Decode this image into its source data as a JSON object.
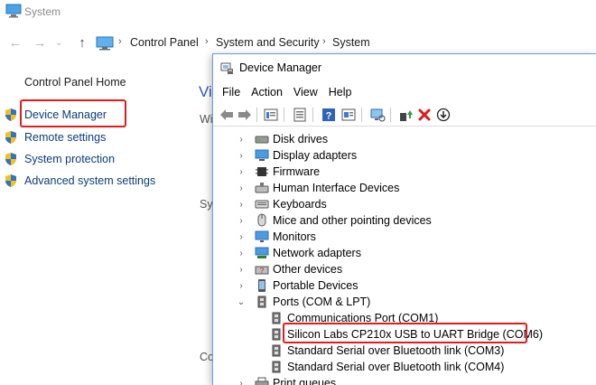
{
  "system_window": {
    "title": "System",
    "breadcrumbs": [
      "Control Panel",
      "System and Security",
      "System"
    ],
    "sidebar": {
      "home": "Control Panel Home",
      "items": [
        {
          "label": "Device Manager",
          "icon": "shield-icon"
        },
        {
          "label": "Remote settings",
          "icon": "shield-icon"
        },
        {
          "label": "System protection",
          "icon": "shield-icon"
        },
        {
          "label": "Advanced system settings",
          "icon": "shield-icon"
        }
      ]
    },
    "peek_text": {
      "heading": "Vi",
      "w": "Wi",
      "sy": "Sy",
      "co": "Co"
    }
  },
  "device_manager": {
    "title": "Device Manager",
    "menu": [
      "File",
      "Action",
      "View",
      "Help"
    ],
    "tree": [
      {
        "label": "Disk drives",
        "expanded": false,
        "icon": "disk-drive-icon"
      },
      {
        "label": "Display adapters",
        "expanded": false,
        "icon": "display-adapter-icon"
      },
      {
        "label": "Firmware",
        "expanded": false,
        "icon": "firmware-icon"
      },
      {
        "label": "Human Interface Devices",
        "expanded": false,
        "icon": "hid-icon"
      },
      {
        "label": "Keyboards",
        "expanded": false,
        "icon": "keyboard-icon"
      },
      {
        "label": "Mice and other pointing devices",
        "expanded": false,
        "icon": "mouse-icon"
      },
      {
        "label": "Monitors",
        "expanded": false,
        "icon": "monitor-icon"
      },
      {
        "label": "Network adapters",
        "expanded": false,
        "icon": "network-adapter-icon"
      },
      {
        "label": "Other devices",
        "expanded": false,
        "icon": "other-devices-icon"
      },
      {
        "label": "Portable Devices",
        "expanded": false,
        "icon": "portable-device-icon"
      },
      {
        "label": "Ports (COM & LPT)",
        "expanded": true,
        "icon": "port-icon"
      },
      {
        "label": "Communications Port (COM1)",
        "child": true,
        "icon": "port-icon"
      },
      {
        "label": "Silicon Labs CP210x USB to UART Bridge (COM6)",
        "child": true,
        "icon": "port-icon",
        "highlighted": true
      },
      {
        "label": "Standard Serial over Bluetooth link (COM3)",
        "child": true,
        "icon": "port-icon"
      },
      {
        "label": "Standard Serial over Bluetooth link (COM4)",
        "child": true,
        "icon": "port-icon"
      },
      {
        "label": "Print queues",
        "expanded": false,
        "icon": "printer-icon"
      }
    ]
  },
  "colors": {
    "highlight": "#e41b1b",
    "link": "#0b3c7a"
  }
}
